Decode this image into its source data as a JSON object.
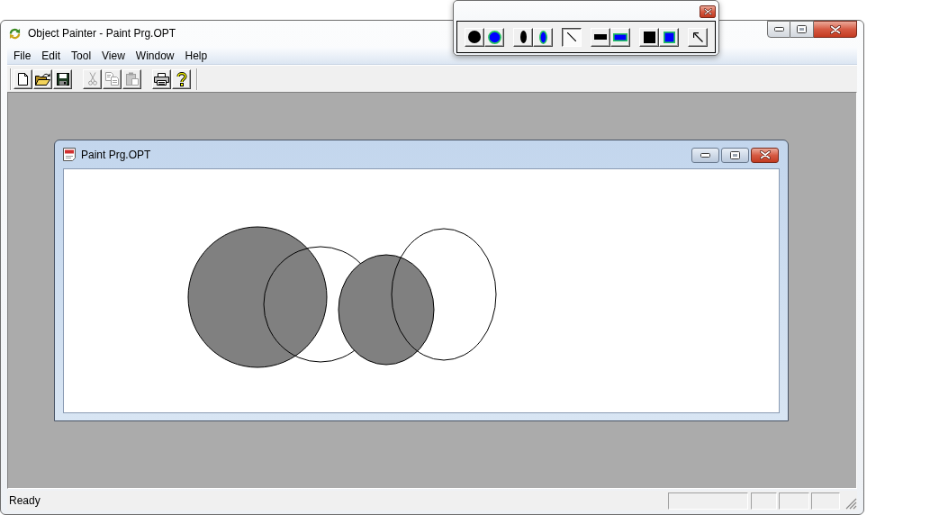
{
  "window": {
    "title": "Object Painter - Paint Prg.OPT"
  },
  "palette": [
    [
      {
        "selected": false
      },
      {
        "selected": false
      }
    ],
    [
      {
        "selected": false
      },
      {
        "selected": false
      }
    ],
    [
      {
        "selected": true
      }
    ],
    [
      {
        "selected": false
      },
      {
        "selected": false
      }
    ],
    [
      {
        "selected": false
      },
      {
        "selected": false
      }
    ],
    [
      {
        "selected": false
      }
    ]
  ],
  "menu": [
    "File",
    "Edit",
    "Tool",
    "View",
    "Window",
    "Help"
  ],
  "toolbar": [
    [
      {
        "disabled": false
      },
      {
        "disabled": false
      },
      {
        "disabled": false
      }
    ],
    [
      {
        "disabled": true
      },
      {
        "disabled": true
      },
      {
        "disabled": true
      }
    ],
    [
      {
        "disabled": false
      },
      {
        "disabled": false
      }
    ]
  ],
  "document": {
    "title": "Paint Prg.OPT",
    "shapes": [
      {
        "filled": true
      },
      {
        "filled": false
      },
      {
        "filled": true
      },
      {
        "filled": false
      }
    ]
  },
  "status_bar": {
    "text": "Ready"
  }
}
